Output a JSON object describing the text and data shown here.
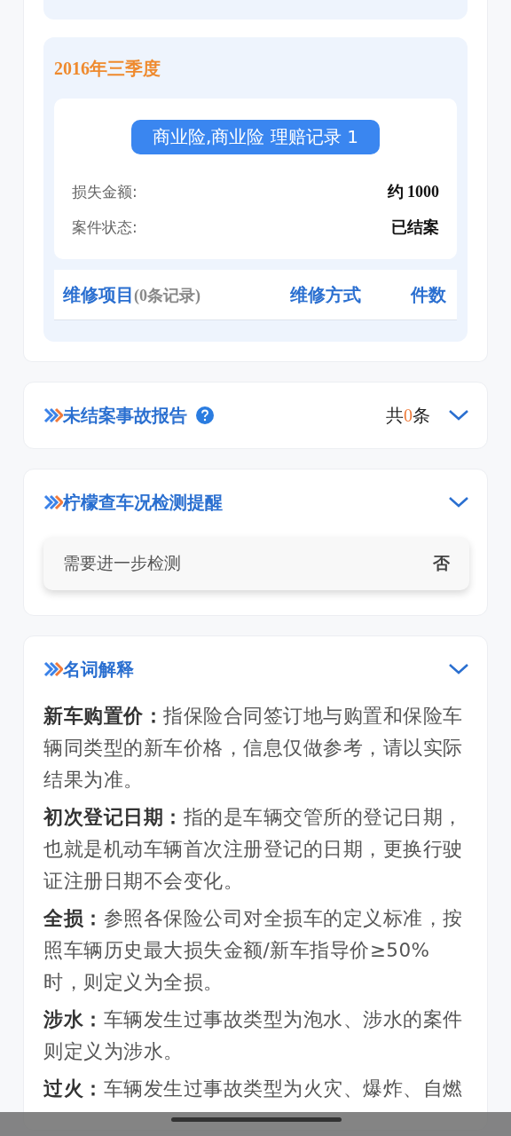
{
  "claim_period": {
    "title": "2016年三季度",
    "claim": {
      "badge": "商业险,商业险 理赔记录 1",
      "rows": [
        {
          "label": "损失金额:",
          "value": "约 1000"
        },
        {
          "label": "案件状态:",
          "value": "已结案"
        }
      ]
    },
    "repair_table": {
      "columns": [
        {
          "label": "维修项目",
          "note": "(0条记录)"
        },
        {
          "label": "维修方式"
        },
        {
          "label": "件数"
        }
      ]
    }
  },
  "sections": [
    {
      "kind": "count",
      "title": "未结案事故报告",
      "help": true,
      "count": {
        "prefix": "共",
        "value": "0",
        "suffix": "条"
      }
    },
    {
      "kind": "check",
      "title": "柠檬查车况检测提醒",
      "help": false,
      "check": {
        "label": "需要进一步检测",
        "value": "否"
      }
    },
    {
      "kind": "glossary",
      "title": "名词解释",
      "help": false,
      "definitions": [
        {
          "term": "新车购置价：",
          "text": "指保险合同签订地与购置和保险车辆同类型的新车价格，信息仅做参考，请以实际结果为准。"
        },
        {
          "term": "初次登记日期：",
          "text": "指的是车辆交管所的登记日期，也就是机动车辆首次注册登记的日期，更换行驶证注册日期不会变化。"
        },
        {
          "term": "全损：",
          "text": "参照各保险公司对全损车的定义标准，按照车辆历史最大损失金额/新车指导价≥50%时，则定义为全损。"
        },
        {
          "term": "涉水：",
          "text": "车辆发生过事故类型为泡水、涉水的案件则定义为涉水。"
        },
        {
          "term": "过火：",
          "text": "车辆发生过事故类型为火灾、爆炸、自燃"
        }
      ]
    }
  ]
}
